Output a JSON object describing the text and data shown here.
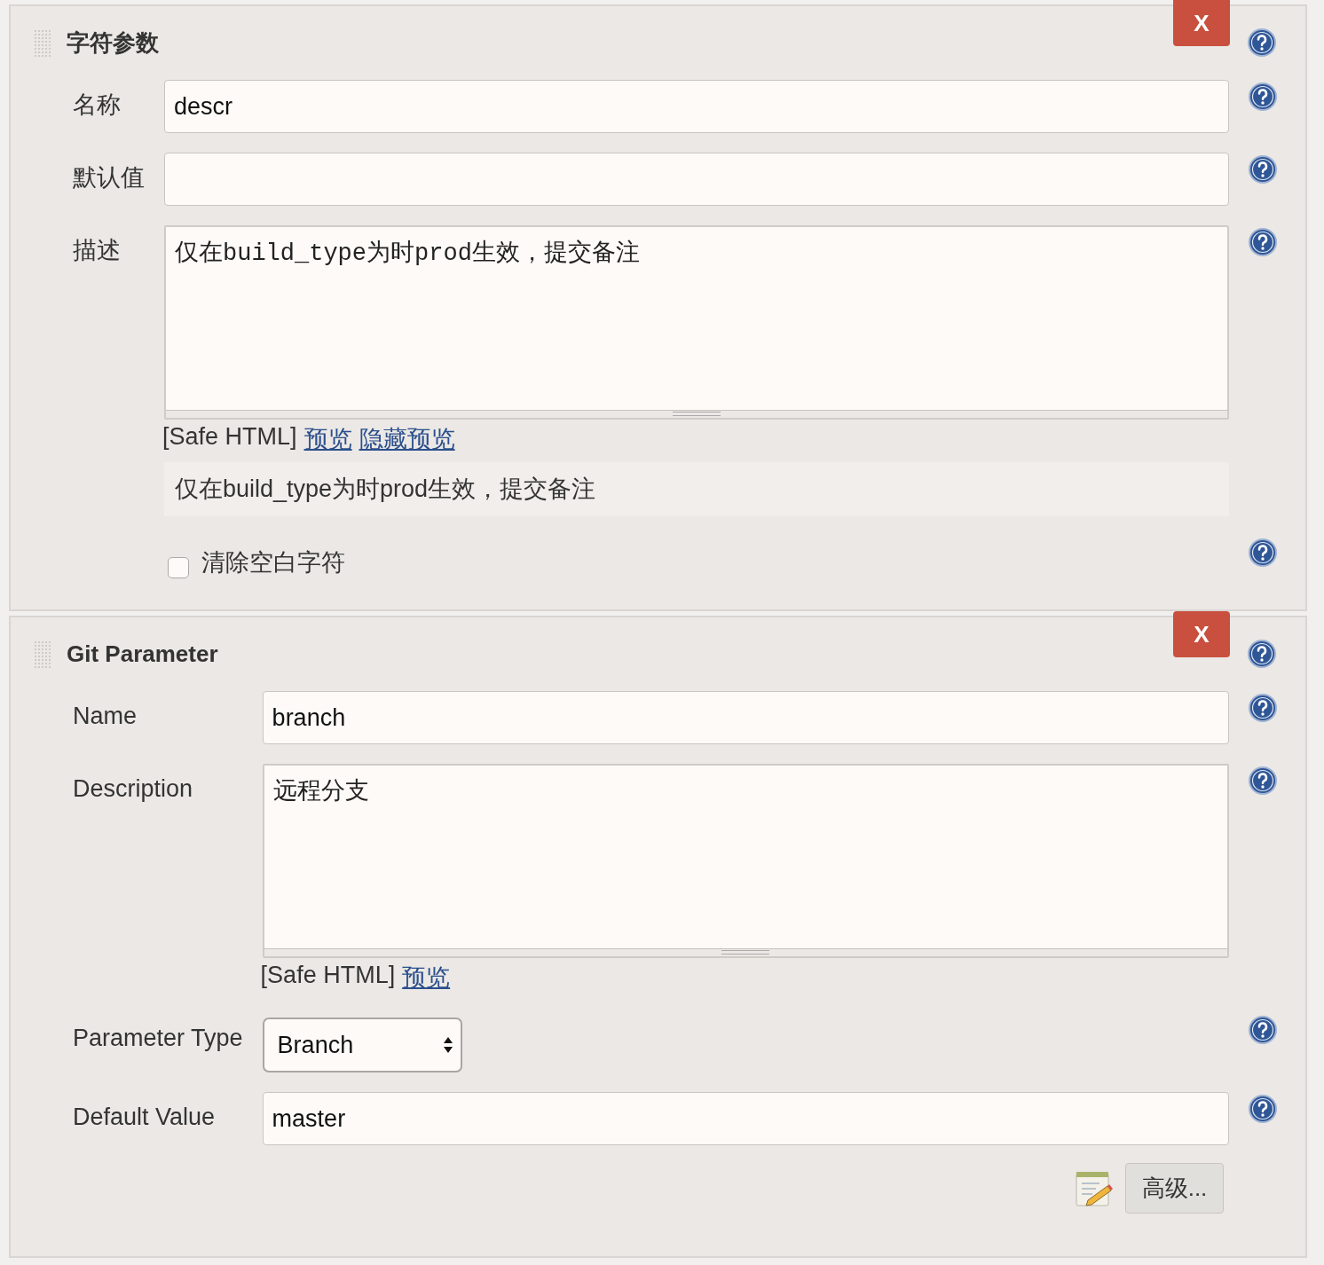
{
  "sections": [
    {
      "title": "字符参数",
      "close_label": "X",
      "rows": [
        {
          "kind": "text",
          "label": "名称",
          "value": "descr"
        },
        {
          "kind": "text",
          "label": "默认值"
        },
        {
          "kind": "textarea",
          "label": "描述",
          "value": "仅在build_type为时prod生效，提交备注",
          "format_note": "[Safe HTML]",
          "links": [
            "预览",
            "隐藏预览"
          ],
          "preview": "仅在build_type为时prod生效，提交备注"
        },
        {
          "kind": "checkbox",
          "label": "清除空白字符",
          "checked": false
        }
      ]
    },
    {
      "title": "Git Parameter",
      "close_label": "X",
      "rows": [
        {
          "kind": "text",
          "label": "Name",
          "value": "branch"
        },
        {
          "kind": "textarea",
          "label": "Description",
          "value": "远程分支",
          "format_note": "[Safe HTML]",
          "links": [
            "预览"
          ]
        },
        {
          "kind": "select",
          "label": "Parameter Type",
          "value": "Branch"
        },
        {
          "kind": "text",
          "label": "Default Value",
          "value": "master"
        }
      ],
      "advanced_button": "高级..."
    }
  ]
}
